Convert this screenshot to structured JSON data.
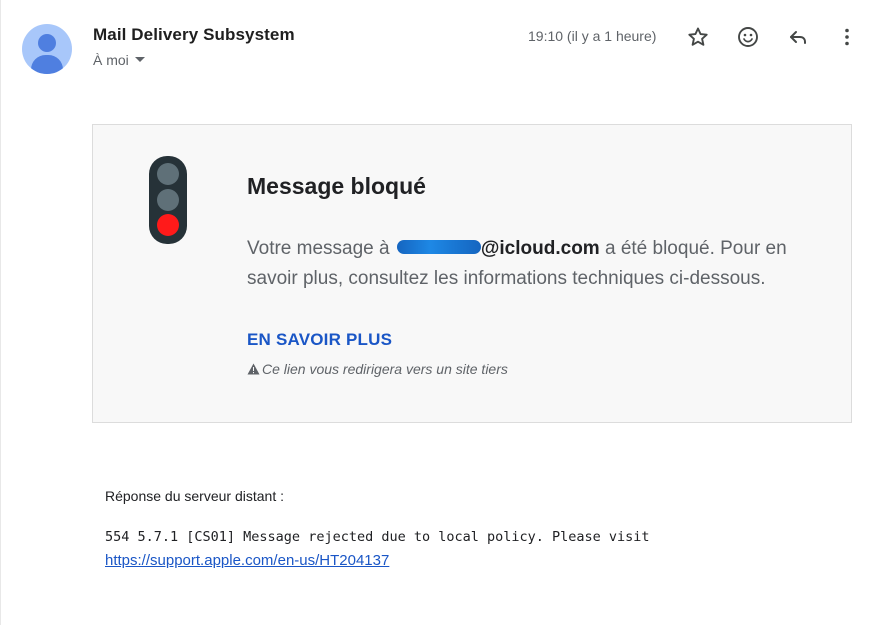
{
  "header": {
    "sender_name": "Mail Delivery Subsystem",
    "recipient_label": "À moi",
    "timestamp": "19:10 (il y a 1 heure)",
    "actions": [
      {
        "icon": "star-icon"
      },
      {
        "icon": "emoji-icon"
      },
      {
        "icon": "reply-icon"
      },
      {
        "icon": "more-vert-icon"
      }
    ]
  },
  "card": {
    "title": "Message bloqué",
    "text_prefix": "Votre message à ",
    "redacted_address": "[redacted]",
    "domain": "@icloud.com",
    "text_suffix": " a été bloqué. Pour en savoir plus, consultez les informations techniques ci-dessous.",
    "learn_more": "EN SAVOIR PLUS",
    "warning": "Ce lien vous redirigera vers un site tiers",
    "traffic_light_active": "red"
  },
  "response": {
    "label": "Réponse du serveur distant :",
    "message": "554 5.7.1 [CS01] Message rejected due to local policy. Please visit",
    "link": "https://support.apple.com/en-us/HT204137"
  },
  "colors": {
    "avatar_bg": "#a8c7fa",
    "avatar_fg": "#4f7fe0",
    "link": "#1a56c6",
    "card_bg": "#f8f8f8",
    "red_light": "#ff1a1a"
  }
}
